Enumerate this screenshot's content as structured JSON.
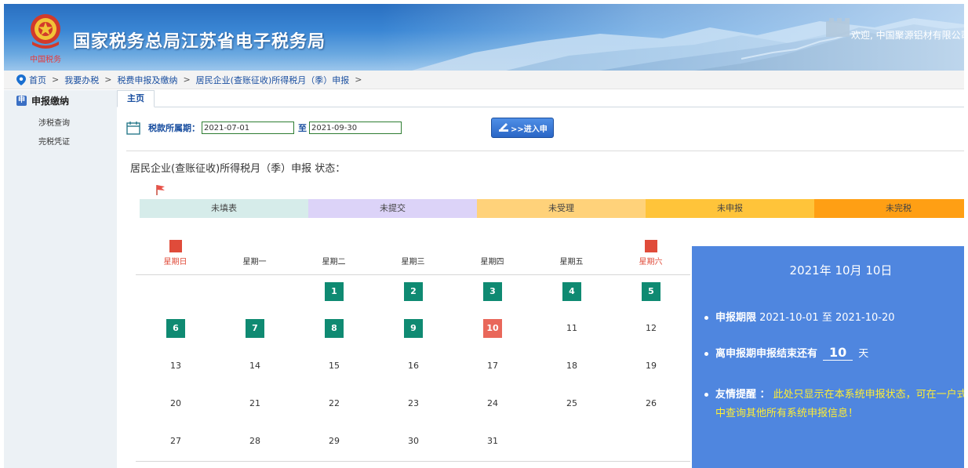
{
  "header": {
    "site_title": "国家税务总局江苏省电子税务局",
    "welcome": "欢迎, 中国聚源铝材有限公司",
    "emblem_seal": "中国税务"
  },
  "breadcrumb": [
    "首页",
    "我要办税",
    "税费申报及缴纳",
    "居民企业(查账征收)所得税月（季）申报"
  ],
  "sidebar": {
    "title": "申报缴纳",
    "badge": "申",
    "items": [
      "涉税查询",
      "完税凭证"
    ]
  },
  "tabs": [
    "主页"
  ],
  "query": {
    "period_label": "税款所属期：",
    "start_date": "2021-07-01",
    "to_label": "至",
    "end_date": "2021-09-30",
    "go_button": ">>进入申"
  },
  "status": {
    "title": "居民企业(查账征收)所得税月（季）申报 状态：",
    "stages": [
      {
        "label": "未填表",
        "color": "#d6ecea"
      },
      {
        "label": "未提交",
        "color": "#dcd3f8"
      },
      {
        "label": "未受理",
        "color": "#ffd27a"
      },
      {
        "label": "未申报",
        "color": "#ffc43a"
      },
      {
        "label": "未完税",
        "color": "#ff9f14"
      }
    ],
    "current_stage": "未填表"
  },
  "calendar": {
    "weekdays": [
      "星期日",
      "星期一",
      "星期二",
      "星期三",
      "星期四",
      "星期五",
      "星期六"
    ],
    "weeks": [
      [
        "",
        "",
        "1",
        "2",
        "3",
        "4",
        "5"
      ],
      [
        "6",
        "7",
        "8",
        "9",
        "10",
        "11",
        "12"
      ],
      [
        "13",
        "14",
        "15",
        "16",
        "17",
        "18",
        "19"
      ],
      [
        "20",
        "21",
        "22",
        "23",
        "24",
        "25",
        "26"
      ],
      [
        "27",
        "28",
        "29",
        "30",
        "31",
        "",
        ""
      ]
    ],
    "filed_days": [
      "1",
      "2",
      "3",
      "4",
      "5",
      "6",
      "7",
      "8",
      "9"
    ],
    "today": "10"
  },
  "info": {
    "date": "2021年 10月 10日",
    "period_label": "申报期限",
    "period_value": "2021-10-01 至 2021-10-20",
    "remain_prefix": "离申报期申报结束还有",
    "remain_days": "10",
    "remain_suffix": "天",
    "tip_label": "友情提醒 ：",
    "tip_line1": "此处只显示在本系统申报状态，可在一户式",
    "tip_line2": "中查询其他所有系统申报信息！"
  }
}
